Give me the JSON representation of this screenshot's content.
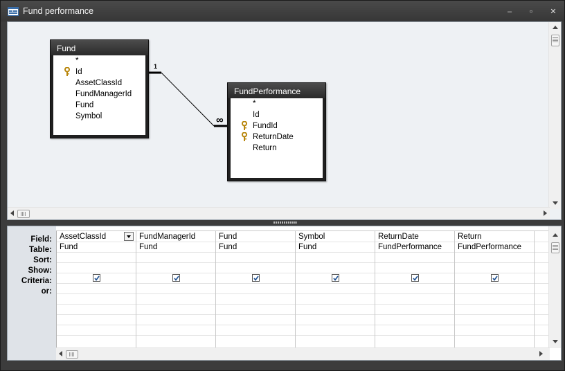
{
  "window": {
    "title": "Fund performance",
    "min_glyph": "–",
    "max_glyph": "▫",
    "close_glyph": "✕"
  },
  "tables": [
    {
      "name": "Fund",
      "fields": [
        {
          "label": "*",
          "key": false
        },
        {
          "label": "Id",
          "key": true
        },
        {
          "label": "AssetClassId",
          "key": false
        },
        {
          "label": "FundManagerId",
          "key": false
        },
        {
          "label": "Fund",
          "key": false
        },
        {
          "label": "Symbol",
          "key": false
        }
      ]
    },
    {
      "name": "FundPerformance",
      "fields": [
        {
          "label": "*",
          "key": false
        },
        {
          "label": "Id",
          "key": false
        },
        {
          "label": "FundId",
          "key": true
        },
        {
          "label": "ReturnDate",
          "key": true
        },
        {
          "label": "Return",
          "key": false
        }
      ]
    }
  ],
  "relationship": {
    "one_label": "1",
    "many_label": "∞"
  },
  "grid": {
    "row_labels": [
      "Field:",
      "Table:",
      "Sort:",
      "Show:",
      "Criteria:",
      "or:"
    ],
    "columns": [
      {
        "field": "AssetClassId",
        "table": "Fund",
        "show": true
      },
      {
        "field": "FundManagerId",
        "table": "Fund",
        "show": true
      },
      {
        "field": "Fund",
        "table": "Fund",
        "show": true
      },
      {
        "field": "Symbol",
        "table": "Fund",
        "show": true
      },
      {
        "field": "ReturnDate",
        "table": "FundPerformance",
        "show": true
      },
      {
        "field": "Return",
        "table": "FundPerformance",
        "show": true
      }
    ]
  },
  "icons": {
    "app": "query-design-icon",
    "key": "primary-key-icon",
    "dropdown": "chevron-down-icon"
  },
  "colors": {
    "window_frame": "#3c3c3c",
    "table_header": "#2a2a2a",
    "design_area": "#eef1f4"
  }
}
